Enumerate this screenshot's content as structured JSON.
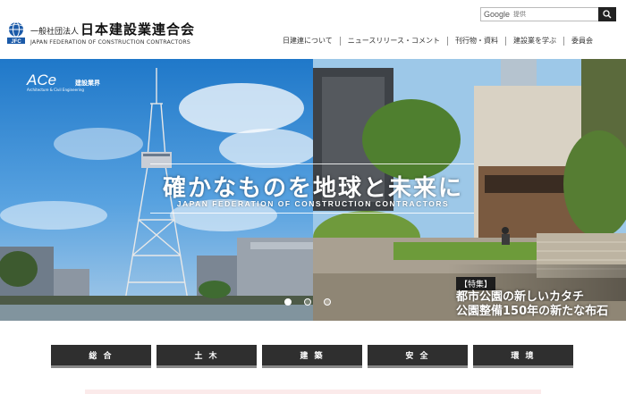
{
  "header": {
    "org_type": "一般社団法人",
    "org_name": "日本建設業連合会",
    "org_name_en": "JAPAN FEDERATION OF CONSTRUCTION CONTRACTORS",
    "logo_mark_text": "JFC"
  },
  "search": {
    "brand": "Google",
    "placeholder": "提供"
  },
  "nav": {
    "items": [
      "日建連について",
      "ニュースリリース・コメント",
      "刊行物・資料",
      "建設業を学ぶ",
      "委員会"
    ]
  },
  "hero": {
    "ace_logo": "ACe",
    "ace_subtitle": "Architecture & Civil Engineering",
    "ace_tag": "建設業界",
    "title": "確かなものを地球と未来に",
    "subtitle_en": "JAPAN FEDERATION OF CONSTRUCTION CONTRACTORS",
    "feature_tag": "【特集】",
    "feature_line1": "都市公園の新しいカタチ",
    "feature_line2": "公園整備150年の新たな布石",
    "slide_count": 3,
    "active_slide": 1
  },
  "categories": [
    "総 合",
    "土 木",
    "建 築",
    "安 全",
    "環 境"
  ],
  "colors": {
    "category_bg": "#2f2f2f",
    "search_button": "#222222",
    "logo_blue": "#1b5aa8"
  }
}
